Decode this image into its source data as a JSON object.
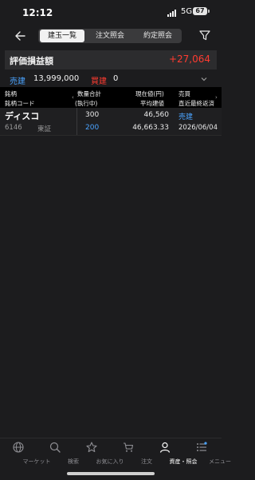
{
  "status_bar": {
    "time": "12:12",
    "network": "5G",
    "battery": "67"
  },
  "nav": {
    "tabs": [
      {
        "label": "建玉一覧",
        "active": true
      },
      {
        "label": "注文照会",
        "active": false
      },
      {
        "label": "約定照会",
        "active": false
      }
    ]
  },
  "pnl": {
    "label": "評価損益額",
    "value": "+27,064"
  },
  "position_summary": {
    "sell_label": "売建",
    "sell_value": "13,999,000",
    "buy_label": "買建",
    "buy_value": "0"
  },
  "table": {
    "header": {
      "col1_top": "銘柄",
      "col1_bottom": "銘柄コード",
      "col2_top": "数量合計",
      "col2_bottom": "(執行中)",
      "col3_top": "現在値(円)",
      "col3_bottom": "平均建値",
      "col4_top": "売買",
      "col4_bottom": "直近最終返済"
    },
    "rows": [
      {
        "name": "ディスコ",
        "code": "6146",
        "market": "東証",
        "quantity": "300",
        "executing": "200",
        "price": "46,560",
        "avg_price": "46,663.33",
        "side": "売建",
        "last_repay": "2026/06/04"
      }
    ]
  },
  "tabbar": {
    "items": [
      {
        "label": "マーケット",
        "icon": "globe-icon"
      },
      {
        "label": "検索",
        "icon": "search-icon"
      },
      {
        "label": "お気に入り",
        "icon": "star-icon"
      },
      {
        "label": "注文",
        "icon": "cart-icon"
      },
      {
        "label": "資産・照会",
        "icon": "person-icon",
        "active": true
      },
      {
        "label": "メニュー",
        "icon": "menu-icon"
      }
    ]
  },
  "colors": {
    "profit": "#ff3b30",
    "sell": "#4aa3ff",
    "buy": "#ff3b30",
    "background": "#1c1c1e"
  }
}
